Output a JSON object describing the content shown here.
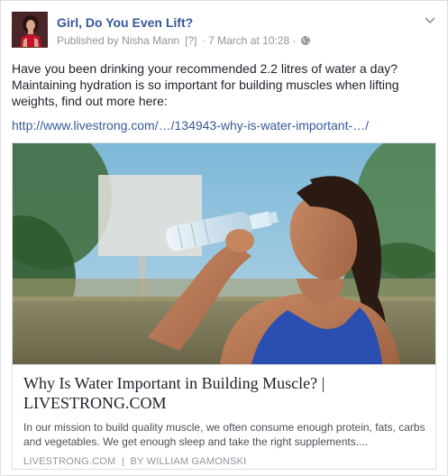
{
  "post": {
    "page_name": "Girl, Do You Even Lift?",
    "published_by_prefix": "Published by",
    "author": "Nisha Mann",
    "author_qmark": "[?]",
    "separator": "·",
    "timestamp": "7 March at 10:28",
    "visibility_separator": "·",
    "visibility_icon": "globe-icon",
    "menu_icon": "chevron-down-icon",
    "text": "Have you been drinking your recommended 2.2 litres of water a day? Maintaining hydration is so important for building muscles when lifting weights, find out more here:",
    "link_text": "http://www.livestrong.com/…/134943-why-is-water-important-…/"
  },
  "card": {
    "image_description_icon": "woman-drinking-water-photo",
    "title": "Why Is Water Important in Building Muscle? | LIVESTRONG.COM",
    "description": "In our mission to build quality muscle, we often consume enough protein, fats, carbs and vegetables. We get enough sleep and take the right supplements....",
    "source": "LIVESTRONG.COM",
    "source_separator": "|",
    "byline": "BY WILLIAM GAMONSKI"
  },
  "colors": {
    "link_blue": "#365899",
    "meta_gray": "#90949c",
    "text_dark": "#1d2129",
    "border": "#dddfe2"
  }
}
